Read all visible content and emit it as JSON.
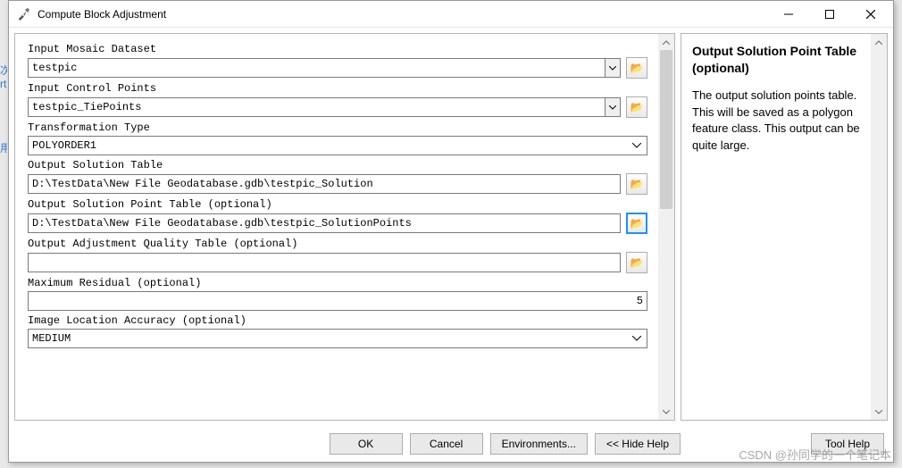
{
  "window": {
    "title": "Compute Block Adjustment"
  },
  "form": {
    "mosaic": {
      "label": "Input Mosaic Dataset",
      "value": "testpic"
    },
    "controlPoints": {
      "label": "Input Control Points",
      "value": "testpic_TiePoints"
    },
    "transType": {
      "label": "Transformation Type",
      "value": "POLYORDER1"
    },
    "outSolution": {
      "label": "Output Solution Table",
      "value": "D:\\TestData\\New File Geodatabase.gdb\\testpic_Solution"
    },
    "outSolutionPoint": {
      "label": "Output Solution Point Table (optional)",
      "value": "D:\\TestData\\New File Geodatabase.gdb\\testpic_SolutionPoints"
    },
    "outQuality": {
      "label": "Output Adjustment Quality Table (optional)",
      "value": ""
    },
    "maxResidual": {
      "label": "Maximum Residual (optional)",
      "value": "5"
    },
    "imgAccuracy": {
      "label": "Image Location Accuracy (optional)",
      "value": "MEDIUM"
    }
  },
  "buttons": {
    "ok": "OK",
    "cancel": "Cancel",
    "env": "Environments...",
    "hideHelp": "<< Hide Help",
    "toolHelp": "Tool Help"
  },
  "help": {
    "title": "Output Solution Point Table (optional)",
    "body": "The output solution points table. This will be saved as a polygon feature class. This output can be quite large."
  },
  "watermark": "CSDN @孙同学的一个笔记本"
}
